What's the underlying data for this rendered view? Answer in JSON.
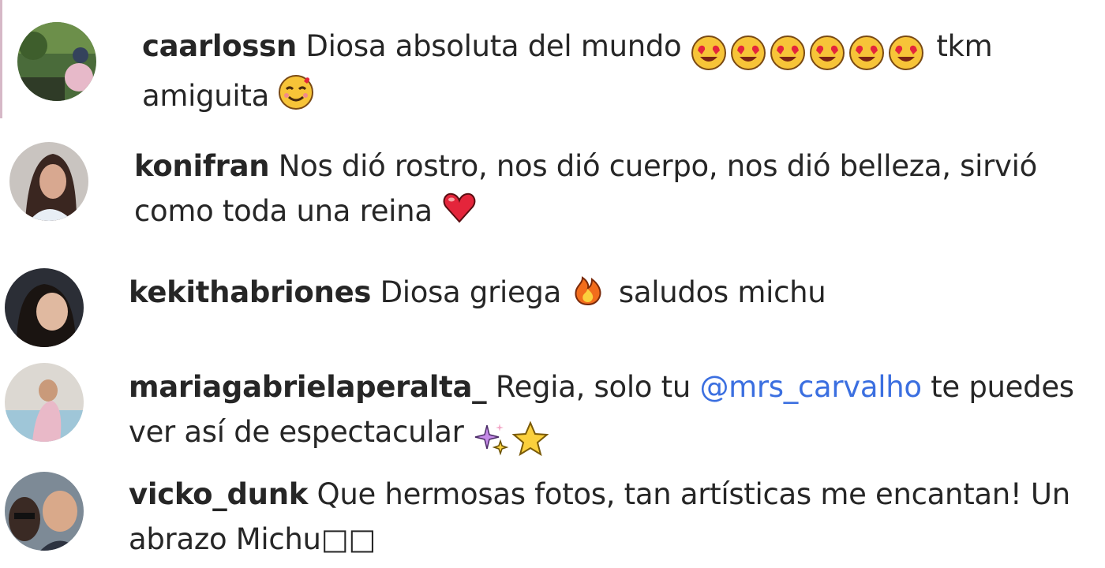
{
  "comments": [
    {
      "username": "caarlossn",
      "line1": "Diosa absoluta del mundo",
      "line1_after": "tkm",
      "line2": "amiguita",
      "emoji_line1": [
        "heart-eyes-emoji",
        "heart-eyes-emoji",
        "heart-eyes-emoji",
        "heart-eyes-emoji",
        "heart-eyes-emoji",
        "heart-eyes-emoji"
      ],
      "emoji_line2": "smiling-hearts-emoji"
    },
    {
      "username": "konifran",
      "line1": "Nos dió rostro, nos dió cuerpo, nos dió belleza, sirvió",
      "line2": "como toda una reina",
      "emoji_line2": "red-heart-emoji"
    },
    {
      "username": "kekithabriones",
      "line1_before": "Diosa griega",
      "line1_after": "saludos michu",
      "emoji_line1": "fire-emoji"
    },
    {
      "username": "mariagabrielaperalta_",
      "line1_before": "Regia, solo tu",
      "mention": "@mrs_carvalho",
      "line1_after": "te puedes",
      "line2": "ver así de espectacular",
      "emoji_line2": [
        "sparkles-emoji",
        "star-emoji"
      ]
    },
    {
      "username": "vicko_dunk",
      "line1": "Que hermosas fotos, tan artísticas me encantan! Un",
      "line2": "abrazo Michu□□"
    }
  ],
  "colors": {
    "text": "#262626",
    "mention": "#3b6fe0"
  }
}
